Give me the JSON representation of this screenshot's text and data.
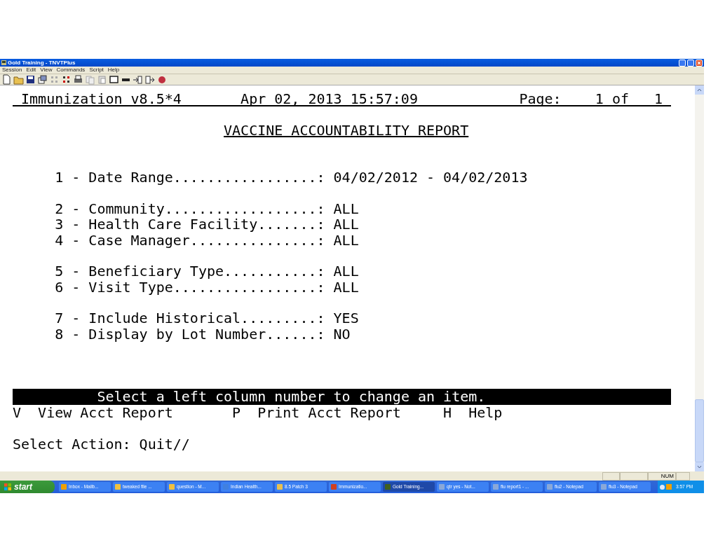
{
  "window": {
    "title": "Gold Training - TNVTPlus"
  },
  "menu": [
    "Session",
    "Edit",
    "View",
    "Commands",
    "Script",
    "Help"
  ],
  "terminal": {
    "header": {
      "app": "Immunization v8.5*4",
      "datetime": "Apr 02, 2013 15:57:09",
      "page_label": "Page:",
      "page": "1 of",
      "pages": "1"
    },
    "report_title": "VACCINE ACCOUNTABILITY REPORT",
    "item_groups": [
      [
        {
          "number": "1 -",
          "label": "Date Range.................:",
          "value": "04/02/2012 - 04/02/2013"
        }
      ],
      [
        {
          "number": "2 -",
          "label": "Community..................:",
          "value": "ALL"
        },
        {
          "number": "3 -",
          "label": "Health Care Facility.......:",
          "value": "ALL"
        },
        {
          "number": "4 -",
          "label": "Case Manager...............:",
          "value": "ALL"
        }
      ],
      [
        {
          "number": "5 -",
          "label": "Beneficiary Type...........:",
          "value": "ALL"
        },
        {
          "number": "6 -",
          "label": "Visit Type.................:",
          "value": "ALL"
        }
      ],
      [
        {
          "number": "7 -",
          "label": "Include Historical.........:",
          "value": "YES"
        },
        {
          "number": "8 -",
          "label": "Display by Lot Number......:",
          "value": "NO"
        }
      ]
    ],
    "prompt_bar": "Select a left column number to change an item.",
    "actions": [
      {
        "key": "V",
        "label": "View Acct Report"
      },
      {
        "key": "P",
        "label": "Print Acct Report"
      },
      {
        "key": "H",
        "label": "Help"
      }
    ],
    "command_line": "Select Action: Quit//"
  },
  "status_bar": {
    "indicator": "NUM"
  },
  "taskbar": {
    "start": "start",
    "tasks": [
      {
        "label": "Inbox - Mailb...",
        "selected": false
      },
      {
        "label": "tweaked file ...",
        "selected": false
      },
      {
        "label": "question - M...",
        "selected": false
      },
      {
        "label": "Indian Health...",
        "selected": false
      },
      {
        "label": "8.5 Patch 3",
        "selected": false
      },
      {
        "label": "Immunizatio...",
        "selected": false
      },
      {
        "label": "Gold Training...",
        "selected": true
      },
      {
        "label": "qtr yes - Not...",
        "selected": false
      },
      {
        "label": "flu report1 - ...",
        "selected": false
      },
      {
        "label": "flu2 - Notepad",
        "selected": false
      },
      {
        "label": "flu3 - Notepad",
        "selected": false
      }
    ],
    "clock": "3:57 PM"
  }
}
